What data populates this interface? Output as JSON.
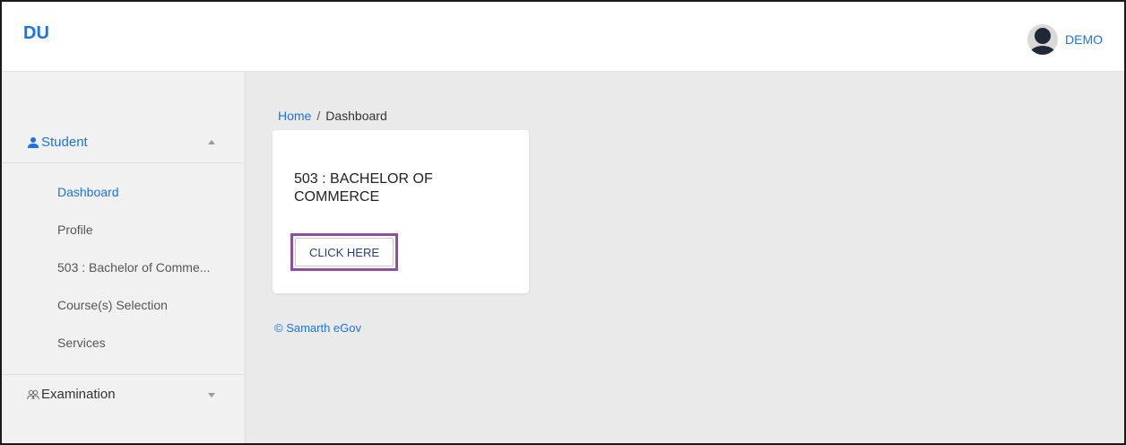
{
  "header": {
    "brand": "DU",
    "user_name": "DEMO"
  },
  "sidebar": {
    "student_label": "Student",
    "items": [
      {
        "label": "Dashboard",
        "active": true
      },
      {
        "label": "Profile"
      },
      {
        "label": "503 : Bachelor of Comme..."
      },
      {
        "label": "Course(s) Selection"
      },
      {
        "label": "Services"
      }
    ],
    "examination_label": "Examination"
  },
  "breadcrumb": {
    "home": "Home",
    "separator": "/",
    "current": "Dashboard"
  },
  "card": {
    "title": "503 : BACHELOR OF COMMERCE",
    "button_label": "CLICK HERE"
  },
  "footer": {
    "text": "© Samarth eGov"
  },
  "colors": {
    "accent": "#1a73e8",
    "highlight_border": "#8e4fa3",
    "sidebar_bg": "#f1f1f1",
    "content_bg": "#eaeaea"
  }
}
